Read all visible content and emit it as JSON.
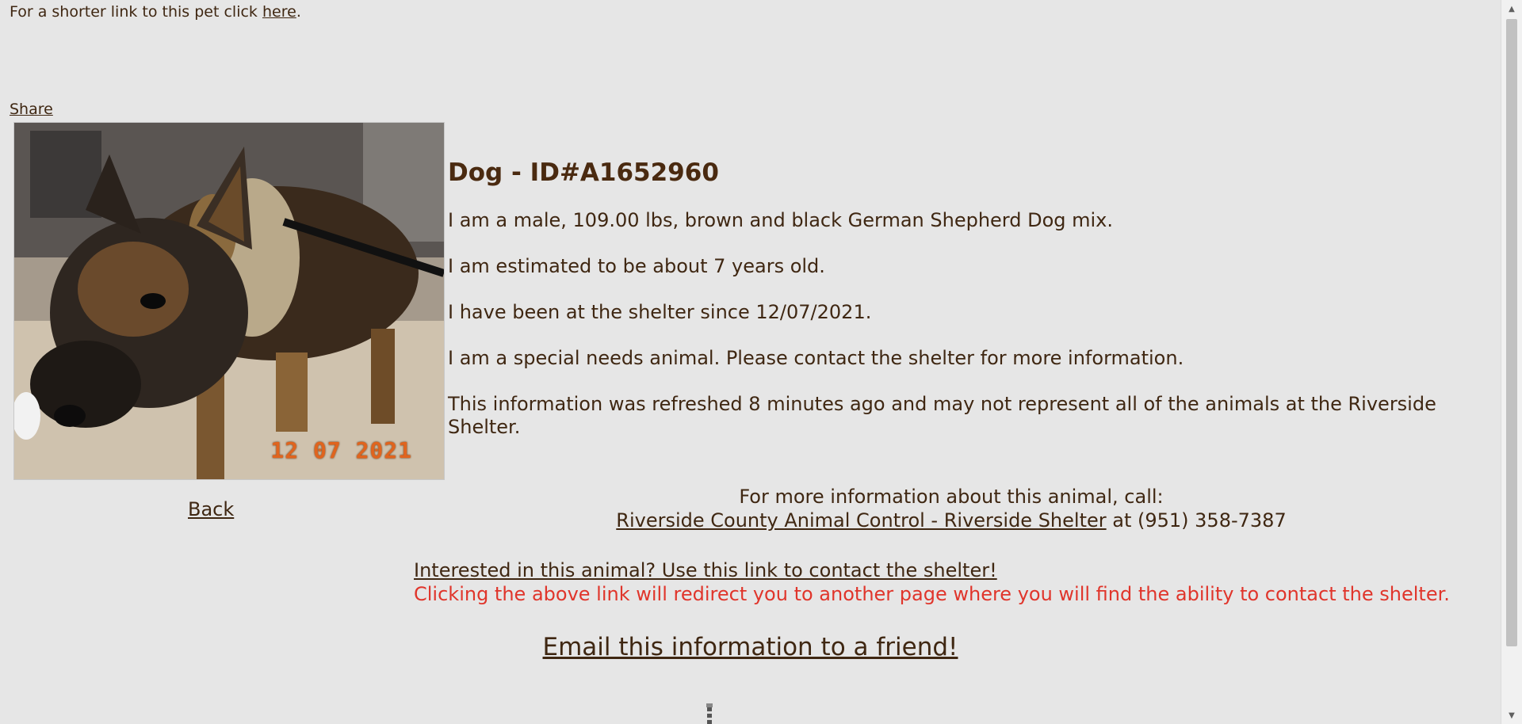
{
  "header": {
    "shortlink_prefix": "For a shorter link to this pet click ",
    "shortlink_link": "here",
    "shortlink_suffix": ".",
    "share": "Share"
  },
  "photo": {
    "datestamp": "12 07 2021"
  },
  "animal": {
    "title": "Dog - ID#A1652960",
    "lines": [
      "I am a male, 109.00 lbs, brown and black German Shepherd Dog mix.",
      "I am estimated to be about 7 years old.",
      "I have been at the shelter since 12/07/2021.",
      "I am a special needs animal. Please contact the shelter for more information.",
      "This information was refreshed 8 minutes ago and may not represent all of the animals at the Riverside Shelter."
    ]
  },
  "nav": {
    "back": "Back"
  },
  "call": {
    "heading": "For more information about this animal, call:",
    "shelter_link": "Riverside County Animal Control - Riverside Shelter",
    "phone": " at (951) 358-7387"
  },
  "contact": {
    "link": "Interested in this animal? Use this link to contact the shelter!",
    "warning": "Clicking the above link will redirect you to another page where you will find the ability to contact the shelter."
  },
  "email": {
    "link": "Email this information to a friend!"
  },
  "colors": {
    "background": "#e6e6e6",
    "text": "#3f2712",
    "warning": "#e0352b",
    "datestamp": "#e0641e"
  }
}
